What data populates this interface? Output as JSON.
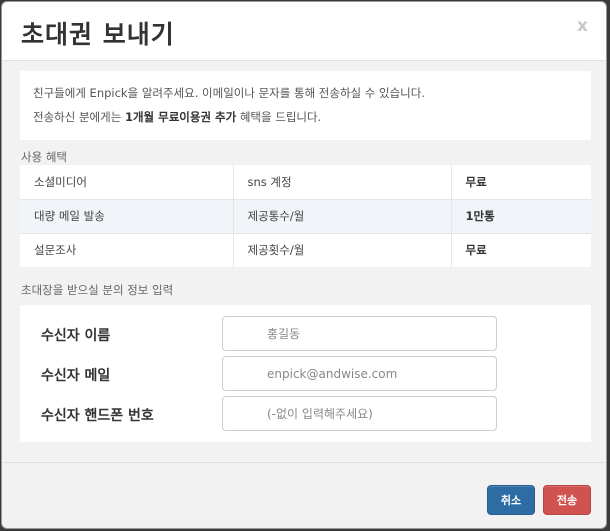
{
  "modal": {
    "title": "초대권 보내기",
    "close_label": "x"
  },
  "notice": {
    "line1": "친구들에게 Enpick을 알려주세요. 이메일이나 문자를 통해 전송하실 수 있습니다.",
    "line2_prefix": "전송하신 분에게는 ",
    "line2_bold": "1개월 무료이용권 추가",
    "line2_suffix": " 혜택을 드립니다."
  },
  "benefits": {
    "section_title": "사용 혜택",
    "rows": [
      {
        "name": "소셜미디어",
        "limit": "sns 계정",
        "price": "무료"
      },
      {
        "name": "대량 메일 발송",
        "limit": "제공통수/월",
        "price": "1만통"
      },
      {
        "name": "설문조사",
        "limit": "제공횟수/월",
        "price": "무료"
      }
    ]
  },
  "recipient": {
    "section_title": "초대장을 받으실 분의 정보 입력",
    "fields": [
      {
        "label": "수신자 이름",
        "placeholder": "홍길동"
      },
      {
        "label": "수신자 메일",
        "placeholder": "enpick@andwise.com"
      },
      {
        "label": "수신자 핸드폰 번호",
        "placeholder": "(-없이 입력해주세요)"
      }
    ]
  },
  "footer": {
    "cancel_label": "취소",
    "send_label": "전송"
  },
  "colors": {
    "primary": "#2e6da4",
    "danger": "#d05350"
  }
}
